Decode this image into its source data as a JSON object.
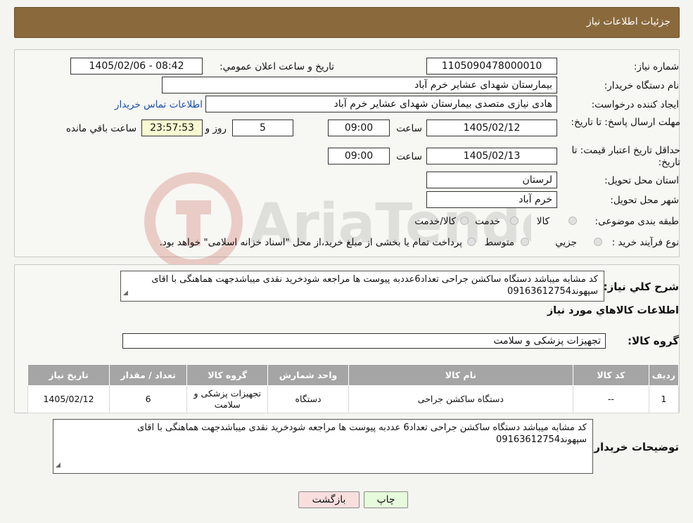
{
  "header": {
    "title": "جزئیات اطلاعات نیاز"
  },
  "fields": {
    "need_number_label": "شماره نیاز:",
    "need_number": "1105090478000010",
    "announce_label": "تاریخ و ساعت اعلان عمومي:",
    "announce_value": "1405/02/06 - 08:42",
    "buyer_org_label": "نام دستگاه خریدار:",
    "buyer_org": "بیمارستان شهدای عشایر خرم آباد",
    "creator_label": "ایجاد کننده درخواست:",
    "creator": "هادی نیازی متصدی بیمارستان شهدای عشایر خرم آباد",
    "contact_link": "اطلاعات تماس خریدار",
    "deadline_label": "مهلت ارسال پاسخ: تا تاریخ:",
    "deadline_date": "1405/02/12",
    "time_label": "ساعت",
    "deadline_time": "09:00",
    "days": "5",
    "days_label": "روز و",
    "remaining": "23:57:53",
    "remaining_label": "ساعت باقي مانده",
    "validity_label": "حداقل تاریخ اعتبار قیمت: تا تاریخ:",
    "validity_date": "1405/02/13",
    "validity_time": "09:00",
    "province_label": "استان محل تحویل:",
    "province": "لرستان",
    "city_label": "شهر محل تحویل:",
    "city": "خرم آباد",
    "category_label": "طبقه بندی موضوعی:",
    "category_options": [
      "کالا",
      "خدمت",
      "کالا/خدمت"
    ],
    "purchase_type_label": "نوع فرآیند خرید :",
    "purchase_options": [
      "جزيي",
      "متوسط"
    ],
    "purchase_note": "پرداخت تمام یا بخشی از مبلغ خرید،از محل \"اسناد خزانه اسلامی\" خواهد بود."
  },
  "description": {
    "label": "شرح کلي نیاز:",
    "text": "کد مشابه میباشد دستگاه ساکشن جراحی تعداد6عددبه پیوست ها مراجعه شودخرید نقدی میباشدجهت هماهنگی با اقای سپهوند09163612754"
  },
  "goods": {
    "section_title": "اطلاعات کالاهاي مورد نیاز",
    "group_label": "گروه کالا:",
    "group_value": "تجهیزات پزشکی و سلامت",
    "columns": [
      "ردیف",
      "کد کالا",
      "نام کالا",
      "واحد شمارش",
      "گروه کالا",
      "تعداد / مقدار",
      "تاریخ نیاز"
    ],
    "rows": [
      {
        "index": "1",
        "code": "--",
        "name": "دستگاه ساکشن جراحی",
        "unit": "دستگاه",
        "group": "تجهیزات پزشکی و سلامت",
        "qty": "6",
        "date": "1405/02/12"
      }
    ]
  },
  "buyer_notes": {
    "label": "توضیحات خریدار:",
    "text": "کد مشابه میباشد دستگاه ساکشن جراحی تعداد6 عددبه پیوست ها مراجعه شودخرید نقدی میباشدجهت هماهنگی با اقای سپهوند09163612754"
  },
  "buttons": {
    "print": "چاپ",
    "back": "بازگشت"
  },
  "colors": {
    "header_bg": "#8a6a3c",
    "table_header": "#a5a5a5",
    "print_btn": "#e6fbdc",
    "back_btn": "#f9dede",
    "link": "#1a4fb0"
  }
}
